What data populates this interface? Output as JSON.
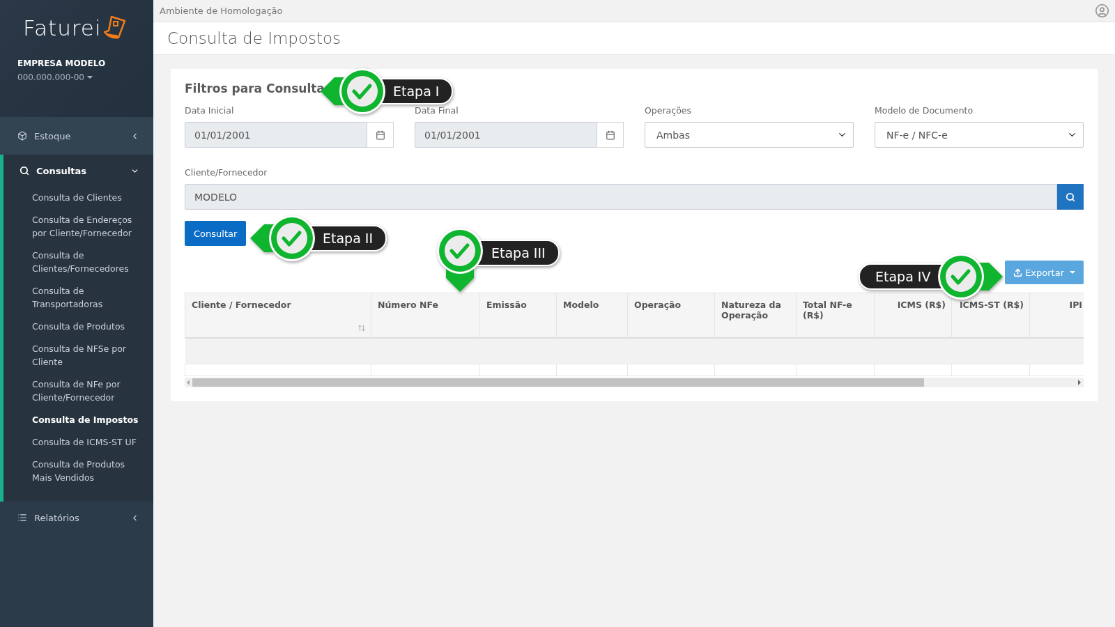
{
  "top_bar": {
    "environment": "Ambiente de Homologação"
  },
  "page_title": "Consulta de Impostos",
  "sidebar": {
    "logo": "Faturei",
    "company": "EMPRESA MODELO",
    "document": "000.000.000-00",
    "menu": [
      {
        "label": "Estoque",
        "expanded": false
      },
      {
        "label": "Consultas",
        "expanded": true,
        "children": [
          {
            "label": "Consulta de Clientes",
            "selected": false
          },
          {
            "label": "Consulta de Endereços por Cliente/Fornecedor",
            "selected": false
          },
          {
            "label": "Consulta de Clientes/Fornecedores",
            "selected": false
          },
          {
            "label": "Consulta de Transportadoras",
            "selected": false
          },
          {
            "label": "Consulta de Produtos",
            "selected": false
          },
          {
            "label": "Consulta de NFSe por Cliente",
            "selected": false
          },
          {
            "label": "Consulta de NFe por Cliente/Fornecedor",
            "selected": false
          },
          {
            "label": "Consulta de Impostos",
            "selected": true
          },
          {
            "label": "Consulta de ICMS-ST UF",
            "selected": false
          },
          {
            "label": "Consulta de Produtos Mais Vendidos",
            "selected": false
          }
        ]
      },
      {
        "label": "Relatórios",
        "expanded": false
      }
    ]
  },
  "filters": {
    "title": "Filtros para Consulta",
    "fields": [
      {
        "kind": "date",
        "label": "Data Inicial",
        "value": "01/01/2001"
      },
      {
        "kind": "date",
        "label": "Data Final",
        "value": "01/01/2001"
      },
      {
        "kind": "select",
        "label": "Operações",
        "value": "Ambas"
      },
      {
        "kind": "select",
        "label": "Modelo de Documento",
        "value": "NF-e / NFC-e"
      }
    ],
    "client": {
      "label": "Cliente/Fornecedor",
      "value": "MODELO"
    },
    "submit": "Consultar"
  },
  "export_button": "Exportar",
  "table": {
    "columns": [
      {
        "label": "Cliente / Fornecedor",
        "sortable": true
      },
      {
        "label": "Número NFe",
        "sortable": false
      },
      {
        "label": "Emissão",
        "sortable": false
      },
      {
        "label": "Modelo",
        "sortable": false
      },
      {
        "label": "Operação",
        "sortable": false
      },
      {
        "label": "Natureza da Operação",
        "sortable": false
      },
      {
        "label": "Total NF-e (R$)",
        "sortable": false
      },
      {
        "label": "ICMS (R$)",
        "sortable": false
      },
      {
        "label": "ICMS-ST (R$)",
        "sortable": false
      },
      {
        "label": "IPI",
        "sortable": false
      }
    ]
  },
  "callouts": [
    {
      "label": "Etapa I",
      "kind": "left"
    },
    {
      "label": "Etapa II",
      "kind": "left"
    },
    {
      "label": "Etapa III",
      "kind": "down"
    },
    {
      "label": "Etapa IV",
      "kind": "right"
    }
  ]
}
